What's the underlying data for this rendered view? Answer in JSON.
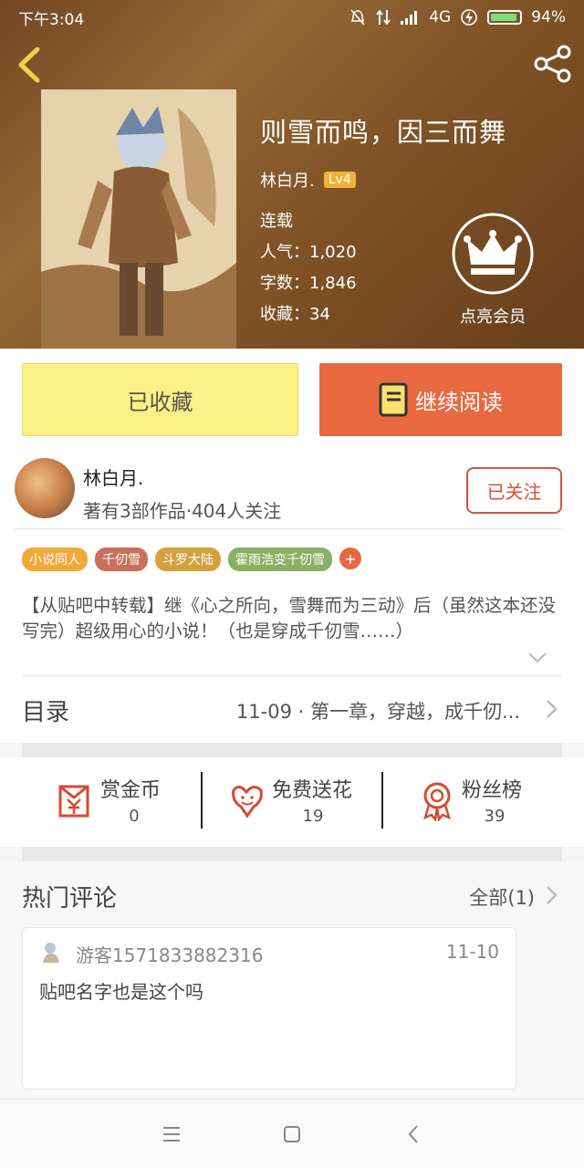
{
  "status": {
    "time": "下午3:04",
    "network": "4G",
    "battery": "94%"
  },
  "book": {
    "title": "则雪而鸣，因三而舞",
    "author": "林白月.",
    "level": "Lv4",
    "status": "连载",
    "popularity": "人气：1,020",
    "word_count": "字数：1,846",
    "favorites": "收藏：34"
  },
  "vip": {
    "label": "点亮会员"
  },
  "actions": {
    "favorited_label": "已收藏",
    "continue_label": "继续阅读"
  },
  "author_card": {
    "name": "林白月.",
    "stats": "著有3部作品·404人关注",
    "follow_label": "已关注"
  },
  "tags": [
    {
      "label": "小说同人",
      "color": "#f1a93b"
    },
    {
      "label": "千仞雪",
      "color": "#c9705a"
    },
    {
      "label": "斗罗大陆",
      "color": "#d4a13f"
    },
    {
      "label": "霍雨浩变千仞雪",
      "color": "#8ab163"
    }
  ],
  "tag_add": "+",
  "description": "【从贴吧中转载】继《心之所向，雪舞而为三动》后（虽然这本还没写完）超级用心的小说！（也是穿成千仞雪……）",
  "catalog": {
    "title": "目录",
    "latest": "11-09 · 第一章，穿越，成千仞..."
  },
  "stats": [
    {
      "label": "赏金币",
      "value": "0",
      "icon": "red-envelope-yen-icon"
    },
    {
      "label": "免费送花",
      "value": "19",
      "icon": "flower-icon"
    },
    {
      "label": "粉丝榜",
      "value": "39",
      "icon": "award-ribbon-icon"
    }
  ],
  "comments": {
    "title": "热门评论",
    "all_label": "全部(1)",
    "items": [
      {
        "user": "游客1571833882316",
        "date": "11-10",
        "text": "贴吧名字也是这个吗"
      }
    ]
  },
  "colors": {
    "accent": "#e8693f",
    "favorite_bg": "#fbf186",
    "follow": "#d9523d",
    "level_badge": "#f0b23a"
  }
}
